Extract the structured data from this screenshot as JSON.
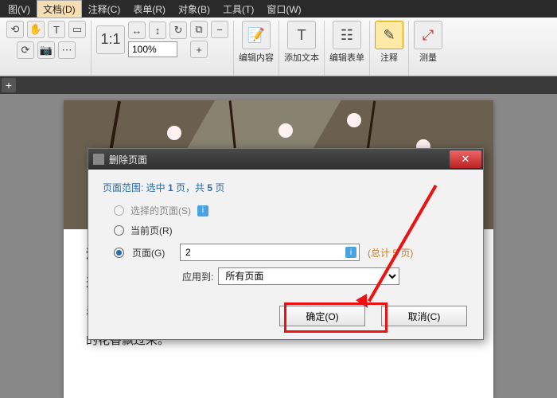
{
  "menu": {
    "items": [
      "图(V)",
      "文档(D)",
      "注释(C)",
      "表单(R)",
      "对象(B)",
      "工具(T)",
      "窗口(W)"
    ],
    "active_index": 1
  },
  "ribbon": {
    "zoom": "100%",
    "groups": {
      "edit_content": "编辑内容",
      "add_text": "添加文本",
      "edit_form": "编辑表单",
      "annotate": "注释",
      "measure": "测量"
    }
  },
  "body_text": {
    "l1": "注释",
    "l2": "这首……抑",
    "l3": "着产……幽",
    "l4": "的花香飘过来。"
  },
  "dialog": {
    "title": "删除页面",
    "range_prefix": "页面范围: 选中 ",
    "range_mid": " 页，共 ",
    "range_suffix": " 页",
    "sel_count": "1",
    "total_count": "5",
    "opt_selected": "选择的页面(S)",
    "opt_current": "当前页(R)",
    "opt_pages": "页面(G)",
    "pages_value": "2",
    "total_label": "(总计 5 页)",
    "apply_label": "应用到:",
    "apply_value": "所有页面",
    "ok": "确定(O)",
    "cancel": "取消(C)"
  }
}
